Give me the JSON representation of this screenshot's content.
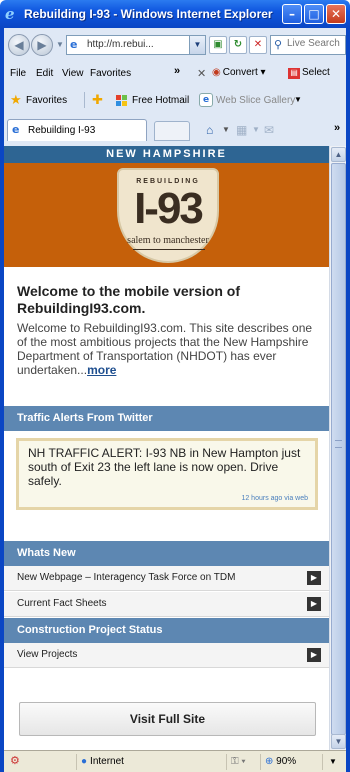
{
  "window": {
    "title": "Rebuilding I-93 - Windows Internet Explorer",
    "min": "–",
    "max": "□",
    "close": "✕"
  },
  "address": {
    "url": "http://m.rebui...",
    "search_placeholder": "Live Search"
  },
  "menu": {
    "items": [
      "File",
      "Edit",
      "View",
      "Favorites"
    ],
    "more": "»",
    "convert_label": "Convert",
    "select_label": "Select"
  },
  "favorites_bar": {
    "favorites_label": "Favorites",
    "links": [
      "Free Hotmail",
      "Web Slice Gallery"
    ]
  },
  "tabs": [
    {
      "label": "Rebuilding I-93"
    }
  ],
  "page": {
    "state_banner": "NEW HAMPSHIRE",
    "logo": {
      "top": "REBUILDING",
      "main": "I-93",
      "bottom": "salem to manchester"
    },
    "welcome_title": "Welcome to the mobile version of RebuildingI93.com.",
    "intro_text": "Welcome to RebuildingI93.com. This site describes one of the most ambitious projects that the New Hampshire Department of Transportation (NHDOT) has ever undertaken...",
    "intro_more": "more",
    "traffic_header": "Traffic Alerts From Twitter",
    "alert_text": "NH TRAFFIC ALERT: I-93 NB in New Hampton just south of Exit 23 the left lane is now open. Drive safely.",
    "alert_time": "12 hours ago via web",
    "whats_new_header": "Whats New",
    "whats_new_items": [
      "New Webpage – Interagency Task Force on TDM",
      "Current Fact Sheets"
    ],
    "construction_header": "Construction Project Status",
    "construction_items": [
      "View Projects"
    ],
    "full_site_button": "Visit Full Site"
  },
  "status_bar": {
    "zone": "Internet",
    "zoom": "90%"
  }
}
